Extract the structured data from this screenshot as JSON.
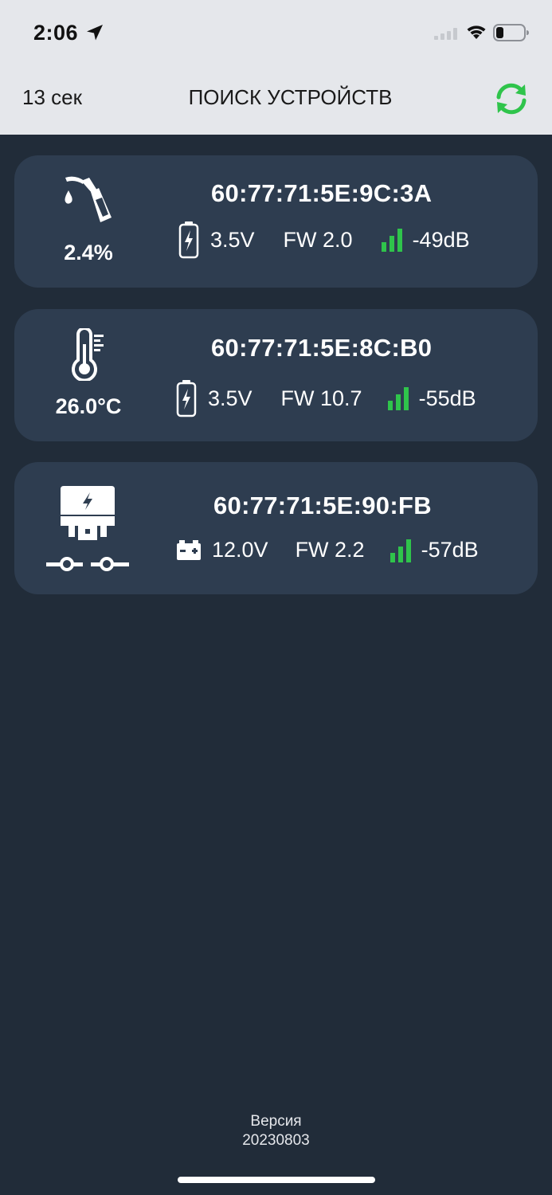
{
  "status_bar": {
    "time": "2:06",
    "icons": [
      "location-arrow-icon",
      "cellular-signal-icon",
      "wifi-icon",
      "battery-icon"
    ]
  },
  "nav": {
    "timer": "13 сек",
    "title": "ПОИСК УСТРОЙСТВ",
    "refresh_icon": "refresh-icon"
  },
  "colors": {
    "nav_background": "#e5e7eb",
    "page_background": "#212c39",
    "card_background": "#2e3d50",
    "accent_green": "#2fc44b",
    "text_primary": "#ffffff"
  },
  "devices": [
    {
      "icon": "fuel-nozzle-icon",
      "reading": "2.4%",
      "mac": "60:77:71:5E:9C:3A",
      "power_icon": "battery-charging-icon",
      "voltage": "3.5V",
      "firmware": "FW 2.0",
      "signal_icon": "signal-bars-icon",
      "rssi": "-49dB"
    },
    {
      "icon": "thermometer-icon",
      "reading": "26.0°C",
      "mac": "60:77:71:5E:8C:B0",
      "power_icon": "battery-charging-icon",
      "voltage": "3.5V",
      "firmware": "FW 10.7",
      "signal_icon": "signal-bars-icon",
      "rssi": "-55dB"
    },
    {
      "icon": "power-relay-icon",
      "reading": "",
      "mac": "60:77:71:5E:90:FB",
      "power_icon": "car-battery-icon",
      "voltage": "12.0V",
      "firmware": "FW 2.2",
      "signal_icon": "signal-bars-icon",
      "rssi": "-57dB"
    }
  ],
  "footer": {
    "version_label": "Версия",
    "version_number": "20230803"
  }
}
